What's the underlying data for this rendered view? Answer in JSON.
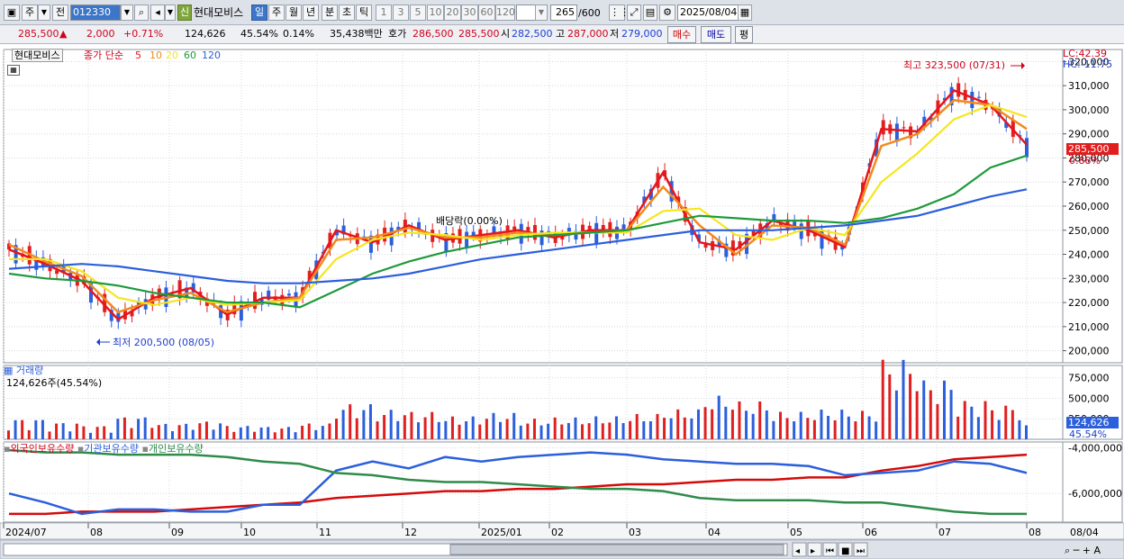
{
  "toolbar": {
    "market_button": "주",
    "prev_button": "전",
    "stock_code": "012330",
    "new_badge": "신",
    "stock_name": "현대모비스",
    "period_buttons": [
      "일",
      "주",
      "월",
      "년",
      "분",
      "초",
      "틱"
    ],
    "interval_buttons": [
      "1",
      "3",
      "5",
      "10",
      "20",
      "30",
      "60",
      "120"
    ],
    "bar_count": "265",
    "bar_total": "/600",
    "date": "2025/08/04"
  },
  "quote": {
    "price": "285,500",
    "arrow": "▲",
    "change": "2,000",
    "change_pct": "+0.71%",
    "volume": "124,626",
    "volume_ratio": "45.54%",
    "turnover_pct": "0.14%",
    "amount": "35,438백만",
    "ask_label": "호가",
    "ask1": "286,500",
    "ask2": "285,500",
    "open_label": "시",
    "open": "282,500",
    "high_label": "고",
    "high": "287,000",
    "low_label": "저",
    "low": "279,000",
    "buy_button": "매수",
    "sell_button": "매도",
    "avg_button": "평"
  },
  "price_panel": {
    "name": "현대모비스",
    "ma_label": "종가 단순",
    "ma_periods": [
      "5",
      "10",
      "20",
      "60",
      "120"
    ],
    "ma_colors": [
      "#e8141c",
      "#f28a1c",
      "#f5e61e",
      "#1e9a3a",
      "#2b5fdb"
    ],
    "lc_label": "LC:42.39",
    "hc_label": "HC:-11.75",
    "high_annotation": "최고 323,500 (07/31)",
    "low_annotation": "최저 200,500 (08/05)",
    "dividend_annotation": "배당락(0.00%)",
    "last_price_tag": "285,500",
    "last_pct_tag": "0.88%",
    "y_ticks": [
      "320,000",
      "310,000",
      "300,000",
      "290,000",
      "280,000",
      "270,000",
      "260,000",
      "250,000",
      "240,000",
      "230,000",
      "220,000",
      "210,000",
      "200,000"
    ]
  },
  "volume_panel": {
    "title": "거래량",
    "summary": "124,626주(45.54%)",
    "y_ticks": [
      "750,000",
      "500,000",
      "250,000"
    ],
    "last_tag": "124,626",
    "last_pct": "45.54%"
  },
  "holdings_panel": {
    "legend": [
      "외국인보유수량",
      "기관보유수량",
      "개인보유수량"
    ],
    "colors": [
      "#d40a0a",
      "#2b5fdb",
      "#2e8b4a"
    ],
    "y_ticks": [
      "-4,000,000",
      "-6,000,000"
    ]
  },
  "x_axis": {
    "labels": [
      "2024/07",
      "08",
      "09",
      "10",
      "11",
      "12",
      "2025/01",
      "02",
      "03",
      "04",
      "05",
      "06",
      "07",
      "08"
    ],
    "right_label": "08/04"
  },
  "chart_data": {
    "type": "line",
    "title": "현대모비스",
    "series": [
      {
        "name": "5",
        "values": [
          242000,
          236000,
          229000,
          213000,
          222000,
          226000,
          215000,
          222000,
          222000,
          250000,
          245000,
          252000,
          246000,
          248000,
          250000,
          247000,
          250000,
          250000,
          274000,
          245000,
          242000,
          254000,
          250000,
          243000,
          292000,
          291000,
          308000,
          302000,
          285500
        ]
      },
      {
        "name": "10",
        "values": [
          244000,
          237000,
          231000,
          216000,
          221000,
          224000,
          216000,
          220000,
          222000,
          246000,
          247000,
          251000,
          247000,
          247000,
          249000,
          248000,
          249000,
          250000,
          268000,
          252000,
          240000,
          252000,
          251000,
          244000,
          285000,
          290000,
          304000,
          302000,
          292000
        ]
      },
      {
        "name": "20",
        "values": [
          238000,
          238000,
          233000,
          222000,
          219000,
          222000,
          219000,
          220000,
          221000,
          238000,
          246000,
          249000,
          248000,
          246000,
          248000,
          249000,
          249000,
          249000,
          258000,
          259000,
          248000,
          246000,
          251000,
          248000,
          270000,
          282000,
          296000,
          302000,
          297000
        ]
      },
      {
        "name": "60",
        "values": [
          232000,
          230000,
          229000,
          227000,
          224000,
          222000,
          220000,
          220000,
          218000,
          225000,
          232000,
          237000,
          241000,
          244000,
          247000,
          248000,
          249000,
          250000,
          253000,
          256000,
          255000,
          254000,
          254000,
          253000,
          255000,
          259000,
          265000,
          276000,
          281000
        ]
      },
      {
        "name": "120",
        "values": [
          234000,
          235000,
          236000,
          235000,
          233000,
          231000,
          229000,
          228000,
          228000,
          229000,
          230000,
          232000,
          235000,
          238000,
          240000,
          242000,
          244000,
          246000,
          248000,
          250000,
          250000,
          250000,
          251000,
          252000,
          254000,
          256000,
          260000,
          264000,
          267000
        ]
      }
    ],
    "volume_k": [
      180,
      150,
      120,
      200,
      140,
      160,
      120,
      110,
      140,
      310,
      260,
      240,
      200,
      230,
      180,
      190,
      200,
      220,
      260,
      380,
      330,
      240,
      260,
      250,
      700,
      520,
      340,
      300,
      124.6
    ],
    "holdings": {
      "외국인보유수량": [
        -6.9,
        -6.9,
        -6.8,
        -6.8,
        -6.8,
        -6.7,
        -6.6,
        -6.5,
        -6.4,
        -6.2,
        -6.1,
        -6.0,
        -5.9,
        -5.9,
        -5.8,
        -5.8,
        -5.7,
        -5.6,
        -5.6,
        -5.5,
        -5.4,
        -5.4,
        -5.3,
        -5.3,
        -5.0,
        -4.8,
        -4.5,
        -4.4,
        -4.3
      ],
      "기관보유수량": [
        -6.0,
        -6.4,
        -6.9,
        -6.7,
        -6.7,
        -6.8,
        -6.8,
        -6.5,
        -6.5,
        -5.0,
        -4.6,
        -4.9,
        -4.4,
        -4.6,
        -4.4,
        -4.3,
        -4.2,
        -4.3,
        -4.5,
        -4.6,
        -4.7,
        -4.7,
        -4.8,
        -5.2,
        -5.1,
        -5.0,
        -4.6,
        -4.7,
        -5.1
      ],
      "개인보유수량": [
        -4.1,
        -4.2,
        -4.2,
        -4.3,
        -4.3,
        -4.3,
        -4.4,
        -4.6,
        -4.7,
        -5.1,
        -5.2,
        -5.4,
        -5.5,
        -5.5,
        -5.6,
        -5.7,
        -5.8,
        -5.8,
        -5.9,
        -6.2,
        -6.3,
        -6.3,
        -6.3,
        -6.4,
        -6.4,
        -6.6,
        -6.8,
        -6.9,
        -6.9
      ]
    },
    "ylim": [
      195000,
      325000
    ]
  },
  "icons": [
    "chart-icon",
    "dropdown-icon",
    "search-icon",
    "speaker-icon",
    "grid-icon",
    "fit-icon",
    "save-icon",
    "settings-icon",
    "calendar-icon"
  ]
}
